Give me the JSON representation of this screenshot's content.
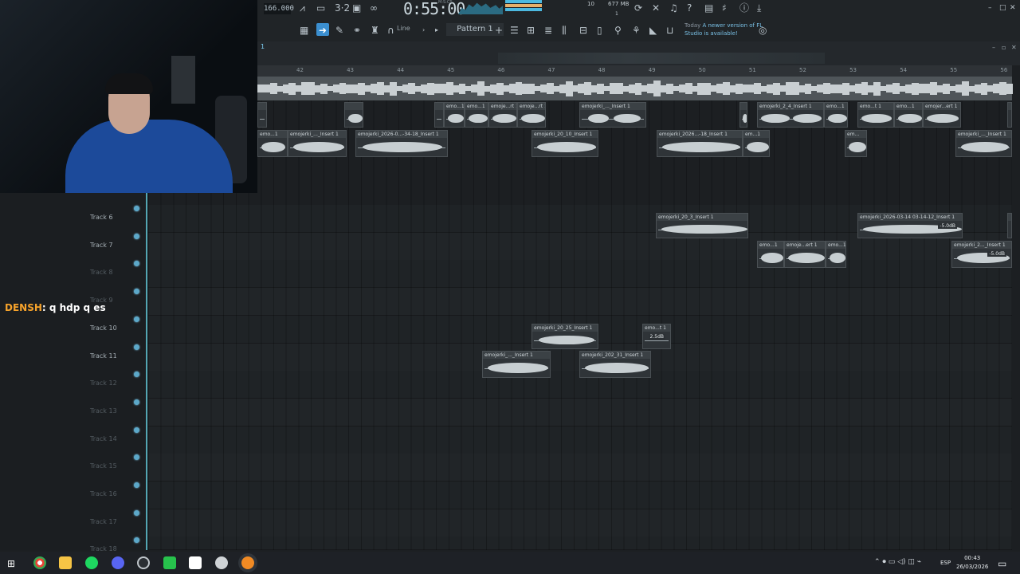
{
  "toolbar": {
    "tempo": "166.000",
    "time": "0:55:00",
    "time_unit": "M:S:CS",
    "cpu": "10",
    "ram": "677 MB",
    "ram_sub": "1",
    "pattern_label": "Pattern 1",
    "draw_mode": "Line",
    "news_today": "Today",
    "news_text": "A newer version of FL Studio is available!"
  },
  "playlist": {
    "number": "1",
    "bars": [
      "42",
      "43",
      "44",
      "45",
      "46",
      "47",
      "48",
      "49",
      "50",
      "51",
      "52",
      "53",
      "54",
      "55",
      "56"
    ]
  },
  "tracks": [
    {
      "name": "Track 6",
      "muted": false
    },
    {
      "name": "Track 7",
      "muted": false
    },
    {
      "name": "Track 8",
      "muted": true
    },
    {
      "name": "Track 9",
      "muted": true
    },
    {
      "name": "Track 10",
      "muted": false
    },
    {
      "name": "Track 11",
      "muted": false
    },
    {
      "name": "Track 12",
      "muted": true
    },
    {
      "name": "Track 13",
      "muted": true
    },
    {
      "name": "Track 14",
      "muted": true
    },
    {
      "name": "Track 15",
      "muted": true
    },
    {
      "name": "Track 16",
      "muted": true
    },
    {
      "name": "Track 17",
      "muted": true
    },
    {
      "name": "Track 18",
      "muted": true
    }
  ],
  "clips": {
    "c1": "emo...1",
    "c2": "emo...1",
    "c3": "emojerki_..._Insert 1",
    "c4": "emojerki_2026-0...-34-18_Insert 1",
    "c5": "emojerki_20_10_Insert 1",
    "c6": "emojerki_2026...-18_Insert 1",
    "c7": "em...1",
    "c8": "em...",
    "c9": "emojerki_..._Insert 1",
    "c10": "emo...1",
    "c11": "emo...1",
    "c12": "emoje...rt 1",
    "c13": "emojerki_..._Insert 1",
    "c14": "emojerki_2_4_Insert 1",
    "c15": "emo...t 1",
    "c16": "emo...1",
    "c17": "emojer...ert 1",
    "c18": "emo...1",
    "c19": "emojerki_20_3_Insert 1",
    "c20": "emojerki_2026-03-14 03-14-12_Insert 1",
    "c20_db": "-5.0dB",
    "c21": "emo...1",
    "c22": "emoje...ert 1",
    "c23": "emo...1",
    "c24": "emojerki_2..._Insert 1",
    "c24_db": "-5.0dB",
    "c25": "emojerki_20_25_Insert 1",
    "c26": "emo...t 1",
    "c26_db": "2.5dB",
    "c27": "emojerki_..._Insert 1",
    "c28": "emojerki_202_31_Insert 1"
  },
  "chat": {
    "user": "DENSH",
    "message": ": q hdp q es"
  },
  "taskbar": {
    "language": "ESP",
    "time": "00:43",
    "date": "26/03/2026"
  },
  "colors": {
    "accent": "#5ca8c9",
    "chat_user": "#f7a32b"
  }
}
